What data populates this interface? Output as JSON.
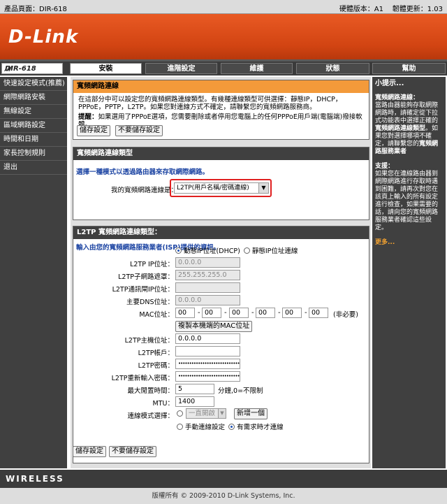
{
  "topbar": {
    "product_page": "產品頁面：DIR-618",
    "hardware_version": "硬體版本：A1",
    "firmware_version": "韌體更新：1.03"
  },
  "brand": {
    "logo": "D-Link",
    "model": "DIR-618"
  },
  "tabs": [
    {
      "label": "安裝",
      "active": true
    },
    {
      "label": "進階設定",
      "active": false
    },
    {
      "label": "維護",
      "active": false
    },
    {
      "label": "狀態",
      "active": false
    },
    {
      "label": "幫助",
      "active": false
    }
  ],
  "sidebar": {
    "items": [
      {
        "label": "快速設定模式(推薦)"
      },
      {
        "label": "網際網路安裝"
      },
      {
        "label": "無線設定"
      },
      {
        "label": "區域網路設定"
      },
      {
        "label": "時間和日期"
      },
      {
        "label": "家長控制規則"
      },
      {
        "label": "退出"
      }
    ]
  },
  "wan_section": {
    "title": "寬頻網路連線",
    "desc": "在這部分中可以設定您的寬頻網路連線類型。有幾種連線類型可供選擇：靜態IP，DHCP，PPPoE，PPTP，L2TP。如果您對連線方式不確定，請聯繫您的寬頻網路服務商。",
    "note_label": "提醒：",
    "note": "如果選用了PPPoE選項，您需要刪除或者停用您電腦上的任何PPPoE用戶端(電腦端)撥接軟體。",
    "save": "儲存設定",
    "cancel": "不要儲存設定"
  },
  "type_section": {
    "title": "寬頻網路連線類型",
    "prompt": "選擇一種模式以透過路由器來存取網際網路。",
    "label": "我的寬頻網路連線是：",
    "value": "L2TP(用戶名稱/密碼連線)"
  },
  "l2tp_section": {
    "title": "L2TP 寬頻網路連線類型：",
    "prompt": "輸入由您的寬頻網路服務業者(ISP)提供的資訊。",
    "dynamic_ip": "動態IP位址(DHCP)",
    "static_ip": "靜態IP位址連線",
    "ip_label": "L2TP IP位址：",
    "ip_value": "0.0.0.0",
    "mask_label": "L2TP子網路遮罩：",
    "mask_value": "255.255.255.0",
    "gw_label": "L2TP通訊閘IP位址：",
    "gw_value": "",
    "dns_label": "主要DNS位址：",
    "dns_value": "0.0.0.0",
    "mac_label": "MAC位址：",
    "mac_values": [
      "00",
      "00",
      "00",
      "00",
      "00",
      "00"
    ],
    "mac_optional": "(非必要)",
    "clone_mac": "複製本機端的MAC位址",
    "server_label": "L2TP主機位址：",
    "server_value": "0.0.0.0",
    "user_label": "L2TP帳戶：",
    "user_value": "",
    "pass_label": "L2TP密碼：",
    "pass_value": "••••••••••••••••••••••••••••",
    "repass_label": "L2TP重新輸入密碼：",
    "repass_value": "••••••••••••••••••••••••••••",
    "idle_label": "最大閒置時間：",
    "idle_value": "5",
    "idle_unit": "分鐘,0=不限制",
    "mtu_label": "MTU：",
    "mtu_value": "1400",
    "mode_label": "連線模式選擇：",
    "always_on": "一直開啟",
    "add_new": "新增一個",
    "manual": "手動連線設定",
    "on_demand": "有需求時才連線"
  },
  "bottom": {
    "save": "儲存設定",
    "cancel": "不要儲存設定"
  },
  "hints": {
    "title": "小提示...",
    "h1": "寬頻網路連線：",
    "p1a": "當路由器能夠存取網際網路時，請確定從下拉式功能表中選擇正確的",
    "p1b": "寬頻網路連線類型",
    "p1c": "。如果您對選擇哪項不確定，請聯繫您的",
    "p1d": "寬頻網路服務業者",
    "h2": "支援：",
    "p2": "如果您在連線路由器到網際網路進行存取時遇到困難，請再次對您在該頁上輸入的所有設定進行檢查，如果需要的話，請向您的寬頻網路服務業者確認這些設定。",
    "more": "更多..."
  },
  "footer": {
    "wireless": "WIRELESS",
    "copyright": "版權所有 © 2009-2010 D-Link Systems, Inc."
  }
}
